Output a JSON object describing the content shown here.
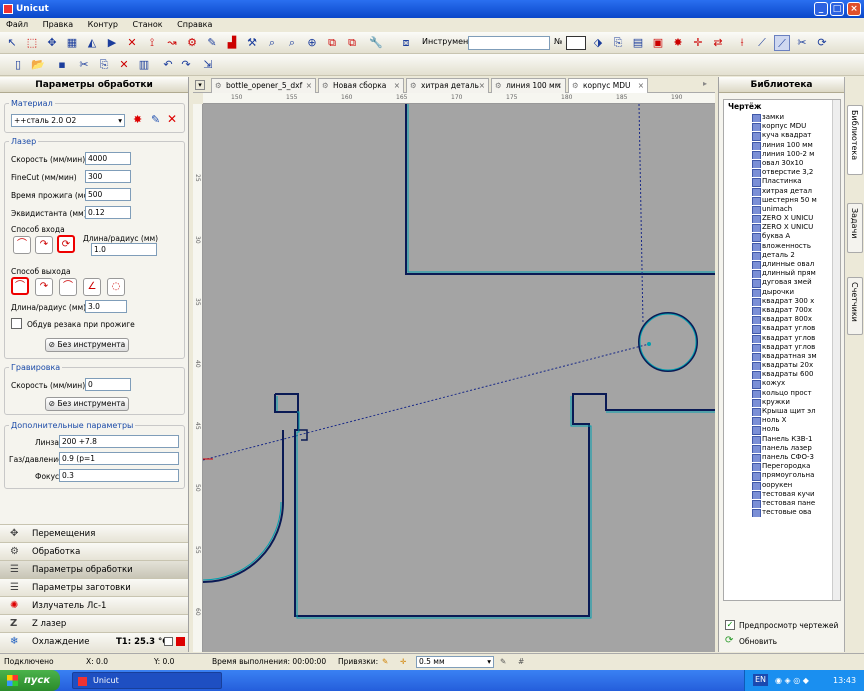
{
  "window": {
    "title": "Unicut"
  },
  "menu": [
    "Файл",
    "Правка",
    "Контур",
    "Станок",
    "Справка"
  ],
  "toolbar": {
    "tool_label": "Инструмент",
    "num_label": "№"
  },
  "left": {
    "title": "Параметры обработки",
    "material": {
      "title": "Материал",
      "value": "++сталь 2.0 О2"
    },
    "laser": {
      "title": "Лазер",
      "speed_label": "Скорость (мм/мин)",
      "speed": "4000",
      "finecut_label": "FineCut (мм/мин)",
      "finecut": "300",
      "pierce_label": "Время прожига (мс)",
      "pierce": "500",
      "equidist_label": "Эквидистанта (мм)",
      "equidist": "0.12",
      "entry_label": "Способ входа",
      "entry_len_label": "Длина/радиус (мм)",
      "entry_len": "1.0",
      "exit_label": "Способ выхода",
      "exit_len_label": "Длина/радиус (мм)",
      "exit_len": "3.0",
      "blow_label": "Обдув резака при прожиге",
      "no_tool": "Без инструмента"
    },
    "engrave": {
      "title": "Гравировка",
      "speed_label": "Скорость (мм/мин)",
      "speed": "0",
      "no_tool": "Без инструмента"
    },
    "extra": {
      "title": "Дополнительные параметры",
      "lens_label": "Линза",
      "lens": "200 +7.8",
      "gas_label": "Газ/давление",
      "gas": "0.9 (р=1",
      "focus_label": "Фокус",
      "focus": "0.3"
    },
    "nav": [
      "Перемещения",
      "Обработка",
      "Параметры обработки",
      "Параметры заготовки",
      "Излучатель Лс-1",
      "Z лазер"
    ],
    "cooling_label": "Охлаждение",
    "cooling_temp": "T1: 25.3 °C"
  },
  "tabs": [
    "bottle_opener_5_dxf",
    "Новая сборка",
    "хитрая деталь",
    "линия 100 мм",
    "корпус MDU"
  ],
  "ruler": {
    "h": [
      "150",
      "155",
      "160",
      "165",
      "170",
      "175",
      "180",
      "185",
      "190"
    ],
    "v": [
      "25",
      "30",
      "35",
      "40",
      "45",
      "50",
      "55",
      "60"
    ]
  },
  "library": {
    "title": "Библиотека",
    "header": "Чертёж",
    "items": [
      "замки",
      "корпус MDU",
      "куча квадрат",
      "линия 100 мм",
      "линия 100-2 м",
      "овал 30х10",
      "отверстие 3,2",
      "Пластинка",
      "хитрая детал",
      "шестерня 50 м",
      "unimach",
      "ZERO X UNICU",
      "ZERO X UNICU",
      "буква А",
      "вложенность",
      "деталь 2",
      "длинные овал",
      "длинный прям",
      "дуговая змей",
      "дырочки",
      "квадрат 300 х",
      "квадрат 700х",
      "квадрат 800х",
      "квадрат углов",
      "квадрат углов",
      "квадрат углов",
      "квадратная зм",
      "квадраты 20х",
      "квадраты 600",
      "кожух",
      "кольцо прост",
      "кружки",
      "Крыша щит эл",
      "ноль Х",
      "ноль",
      "Панель КЗВ-1",
      "панель лазер",
      "панель СФО-3",
      "Перегородка",
      "прямоугольна",
      "оорукен",
      "тестовая кучи",
      "тестовая пане",
      "тестовые ова"
    ],
    "preview_label": "Предпросмотр чертежей",
    "refresh_label": "Обновить"
  },
  "sidetabs": [
    "Библиотека",
    "Задачи",
    "Счетчики"
  ],
  "status": {
    "state": "Подключено",
    "x": "X: 0.0",
    "y": "Y: 0.0",
    "time": "Время выполнения: 00:00:00",
    "snap_label": "Привязки:",
    "snap_value": "0.5 мм"
  },
  "taskbar": {
    "start": "пуск",
    "app": "Unicut",
    "lang": "EN",
    "clock": "13:43"
  },
  "colors": {
    "canvas": "#a4a4a4",
    "part": "#0a1a55",
    "path": "#00a0b0",
    "accent": "#e00000"
  }
}
